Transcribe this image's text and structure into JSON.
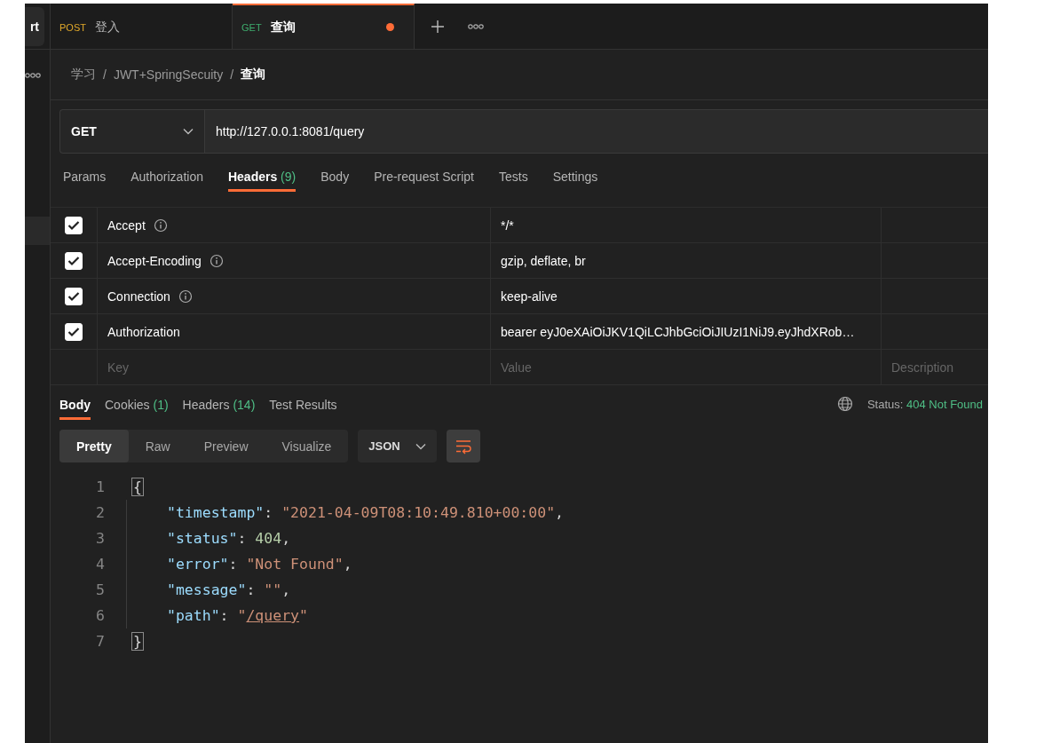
{
  "sidebar": {
    "button_label": "rt"
  },
  "tabs": [
    {
      "method": "POST",
      "name": "登入",
      "selected": false,
      "unsaved": false
    },
    {
      "method": "GET",
      "name": "查询",
      "selected": true,
      "unsaved": true
    }
  ],
  "breadcrumb": [
    {
      "kind": "item",
      "text": "学习"
    },
    {
      "kind": "separator",
      "text": "/"
    },
    {
      "kind": "item",
      "text": "JWT+SpringSecuity"
    },
    {
      "kind": "separator",
      "text": "/"
    },
    {
      "kind": "current",
      "text": "查询"
    }
  ],
  "request": {
    "method": "GET",
    "url": "http://127.0.0.1:8081/query"
  },
  "request_tabs": [
    {
      "label": "Params",
      "selected": false
    },
    {
      "label": "Authorization",
      "selected": false
    },
    {
      "label": "Headers",
      "count": "(9)",
      "selected": true
    },
    {
      "label": "Body",
      "selected": false
    },
    {
      "label": "Pre-request Script",
      "selected": false
    },
    {
      "label": "Tests",
      "selected": false
    },
    {
      "label": "Settings",
      "selected": false
    }
  ],
  "headers": {
    "rows": [
      {
        "checked": true,
        "key": "Accept",
        "info": true,
        "value": "*/*"
      },
      {
        "checked": true,
        "key": "Accept-Encoding",
        "info": true,
        "value": "gzip, deflate, br"
      },
      {
        "checked": true,
        "key": "Connection",
        "info": true,
        "value": "keep-alive"
      },
      {
        "checked": true,
        "key": "Authorization",
        "info": false,
        "value": "bearer eyJ0eXAiOiJKV1QiLCJhbGciOiJIUzI1NiJ9.eyJhdXRob…"
      }
    ],
    "new_row": {
      "key": {
        "placeholder": "Key"
      },
      "value": {
        "placeholder": "Value"
      },
      "description": {
        "placeholder": "Description"
      }
    }
  },
  "response_tabs": [
    {
      "label": "Body",
      "selected": true
    },
    {
      "label": "Cookies",
      "count": "(1)",
      "selected": false
    },
    {
      "label": "Headers",
      "count": "(14)",
      "selected": false
    },
    {
      "label": "Test Results",
      "selected": false
    }
  ],
  "status": {
    "label": "Status:",
    "value": "404 Not Found"
  },
  "view_modes": [
    {
      "label": "Pretty",
      "selected": true
    },
    {
      "label": "Raw",
      "selected": false
    },
    {
      "label": "Preview",
      "selected": false
    },
    {
      "label": "Visualize",
      "selected": false
    }
  ],
  "format": "JSON",
  "wrap": {
    "on": true
  },
  "code": [
    {
      "number": "1",
      "kind": "brace",
      "text": "{"
    },
    {
      "number": "2",
      "kind": "member",
      "key": "\"timestamp\"",
      "colon": ": ",
      "value": [
        {
          "kind": "string",
          "text": "\"2021-04-09T08:10:49.810+00:00\""
        }
      ],
      "trailing": ","
    },
    {
      "number": "3",
      "kind": "member",
      "key": "\"status\"",
      "colon": ": ",
      "value": [
        {
          "kind": "number",
          "text": "404"
        }
      ],
      "trailing": ","
    },
    {
      "number": "4",
      "kind": "member",
      "key": "\"error\"",
      "colon": ": ",
      "value": [
        {
          "kind": "string",
          "text": "\"Not Found\""
        }
      ],
      "trailing": ","
    },
    {
      "number": "5",
      "kind": "member",
      "key": "\"message\"",
      "colon": ": ",
      "value": [
        {
          "kind": "string",
          "text": "\"\""
        }
      ],
      "trailing": ","
    },
    {
      "number": "6",
      "kind": "member",
      "key": "\"path\"",
      "colon": ": ",
      "value": [
        {
          "kind": "string",
          "text": "\""
        },
        {
          "kind": "link",
          "text": "/query"
        },
        {
          "kind": "string",
          "text": "\""
        }
      ]
    },
    {
      "number": "7",
      "kind": "brace",
      "text": "}"
    }
  ]
}
